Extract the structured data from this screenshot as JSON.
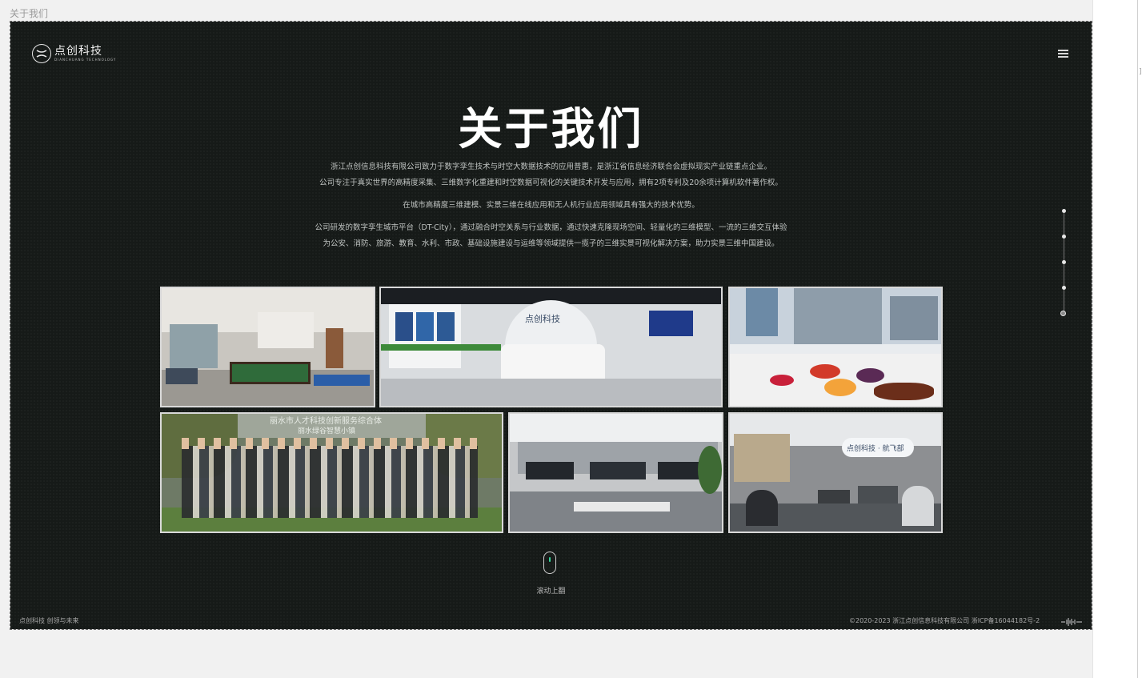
{
  "window": {
    "title": "关于我们"
  },
  "header": {
    "logo_name": "点创科技",
    "logo_sub": "DIANCHUANG TECHNOLOGY",
    "menu_icon": "hamburger-menu-icon"
  },
  "main": {
    "heading": "关于我们",
    "paragraphs": [
      "浙江点创信息科技有限公司致力于数字孪生技术与时空大数据技术的应用普惠，是浙江省信息经济联合会虚拟现实产业链重点企业。",
      "公司专注于真实世界的高精度采集、三维数字化重建和时空数据可视化的关键技术开发与应用，拥有2项专利及20余项计算机软件著作权。",
      "在城市高精度三维建模、实景三维在线应用和无人机行业应用领域具有强大的技术优势。",
      "公司研发的数字孪生城市平台（DT-City），通过融合时空关系与行业数据，通过快速克隆现场空间、轻量化的三维模型、一流的三维交互体验",
      "为公安、消防、旅游、教育、水利、市政、基础设施建设与运维等领域提供一揽子的三维实景可视化解决方案，助力实景三维中国建设。"
    ],
    "photos": [
      {
        "name": "photo-lounge-billiards"
      },
      {
        "name": "photo-reception-hall",
        "sign": "点创科技"
      },
      {
        "name": "photo-window-fruit-table"
      },
      {
        "name": "photo-team-group",
        "banner": "丽水市人才科技创新服务综合体",
        "banner2": "丽水绿谷智慧小镇"
      },
      {
        "name": "photo-open-office"
      },
      {
        "name": "photo-aviation-department",
        "sign": "点创科技 · 航飞部"
      }
    ],
    "scroll_hint": "滚动上翻"
  },
  "side_nav": {
    "dots": 5,
    "active_index": 4
  },
  "footer": {
    "left": "点创科技 创领与未来",
    "right": "©2020-2023 浙江点创信息科技有限公司 浙ICP备16044182号-2"
  },
  "colors": {
    "canvas": "#161a18",
    "accent": "#34d399",
    "text": "#ffffff"
  }
}
